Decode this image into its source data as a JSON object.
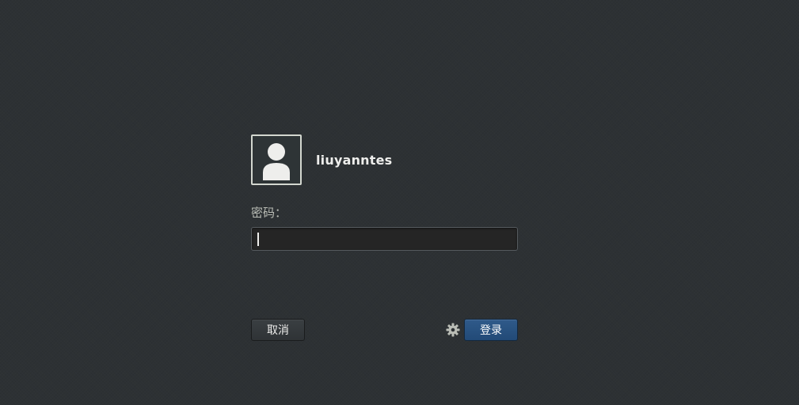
{
  "user": {
    "name": "liuyanntes",
    "avatar_icon": "user-silhouette-icon"
  },
  "password": {
    "label": "密码：",
    "value": ""
  },
  "buttons": {
    "cancel_label": "取消",
    "login_label": "登录",
    "settings_icon": "gear-icon"
  },
  "colors": {
    "background": "#2d3134",
    "login_button": "#224a77",
    "field_background": "#252525"
  }
}
